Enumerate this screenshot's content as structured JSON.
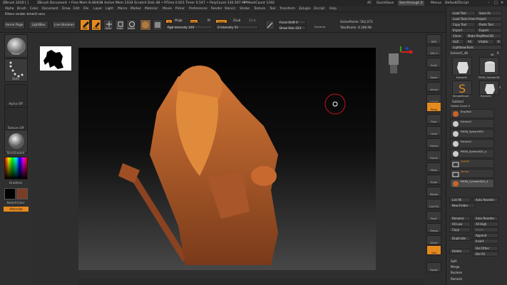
{
  "titlebar": {
    "app": "ZBrush 2020 [ ]",
    "document": "ZBrush Document",
    "free_mem": "• Free Mem 8.484GB",
    "active_mem": "• Active Mem 2333",
    "scratch_disk": "• Scratch Disk 48",
    "rtime": "• RTime 0.621",
    "timer": "Timer 0.547",
    "polycount": "• PolyCount 330.567 MP",
    "meshcount": "• MeshCount 1292",
    "ac": "AC",
    "quicksave": "QuickSave",
    "see_through": "See-through 0",
    "menus": "Menus",
    "script": "DefaultZScript"
  },
  "menus": [
    "Alpha",
    "Brush",
    "Color",
    "Document",
    "Draw",
    "Edit",
    "File",
    "Layer",
    "Light",
    "Macro",
    "Marker",
    "Material",
    "Movie",
    "Picker",
    "Preferences",
    "Render",
    "Stencil",
    "Stroke",
    "Texture",
    "Tool",
    "Transform",
    "Zplugin",
    "Zscript",
    "Help"
  ],
  "note": "Filters render timer0 secs",
  "toolbar": {
    "home_page": "Home Page",
    "lightbox": "LightBox",
    "live_boolean": "Live Boolean",
    "edit": "Edit",
    "draw": "Draw",
    "move": "Move",
    "scale": "Scale",
    "rotate": "Rotate",
    "mrgb": "Mrgb",
    "rgb": "Rgb",
    "m": "M",
    "zadd": "Zadd",
    "zsub": "Zsub",
    "zcut": "Zcut",
    "rgb_intensity": "Rgb Intensity 100",
    "z_intensity": "Z Intensity 51",
    "focal_shift": "Focal Shift 0",
    "draw_size": "Draw Size 223",
    "dynamic": "Dynamic",
    "active_points": "ActivePoints: 562,073",
    "total_points": "TotalPoints: 8.308 Mil"
  },
  "left_tray": {
    "brush": "Move",
    "stroke": "Dots",
    "alpha": "Alpha Off",
    "texture": "Texture Off",
    "material": "SkinShade4",
    "gradient": "Gradient",
    "switch_color": "SwitchColor",
    "alternate": "Alternate"
  },
  "colors": {
    "accent": "#e58a1f",
    "primary_color": "#000000",
    "secondary_color": "#7a3e26",
    "model": "#c8642a"
  },
  "shelf": [
    "BPR",
    "SPix 3",
    "Scroll",
    "Zoom",
    "Actual",
    "AAHalf",
    "Persp",
    "Floor",
    "Local",
    "Gizmo",
    "Frame",
    "Move",
    "Scale",
    "Rotate",
    "Line Fill",
    "PolyF",
    "Transp",
    "Ghost",
    "Solo",
    "Xpose"
  ],
  "right_panel": {
    "load_tool": "Load Tool",
    "save_as": "Save As",
    "load_tools_from_project": "Load Tools From Project",
    "copy_tool": "Copy Tool",
    "paste_tool": "Paste Tool",
    "import": "Import",
    "export": "Export",
    "clone": "Clone",
    "make_polymesh": "Make PolyMesh3D",
    "goz": "GoZ",
    "all": "All",
    "visible": "Visible",
    "r": "R",
    "lightbox_tools": "Lightbox▸Tools",
    "current_tool": "Extract1_48",
    "r_label": "R",
    "thumbs": [
      "Extract1",
      "PM3D_Cylinder3D",
      "SimpleBrush",
      "Extract1"
    ],
    "thumb_counts": [
      "48",
      "3"
    ],
    "subtool_title": "Subtool",
    "visible_count": "Visible Count 9",
    "subtools": [
      "Eng Ball",
      "Extract1",
      "PM3D_Sphere3D1",
      "Extract1",
      "PM3D_Sphere3D1_4",
      "VOPOP",
      "Vertex",
      "PM3D_Cylinder3D1_4"
    ],
    "list_all": "List All",
    "auto_reorder": "Auto Reorder",
    "new_folder": "New Folder",
    "rename": "Rename",
    "all_low": "All Low",
    "all_high": "All High",
    "copy": "Copy",
    "paste": "Paste",
    "duplicate": "Duplicate",
    "append": "Append",
    "insert": "Insert",
    "delete": "Delete",
    "del_other": "Del Other",
    "del_all": "Del All",
    "split": "Split",
    "merge": "Merge",
    "boolean": "Boolean",
    "remesh": "Remesh"
  }
}
